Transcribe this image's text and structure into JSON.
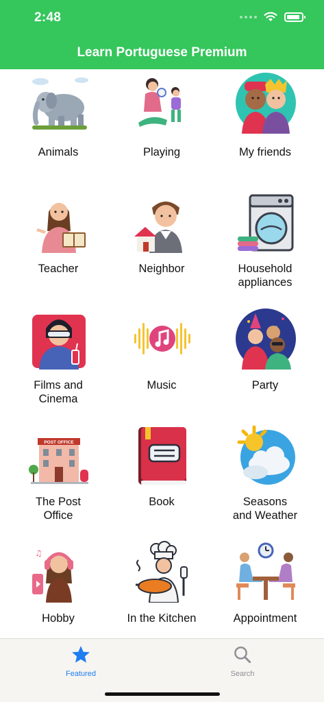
{
  "status_bar": {
    "time": "2:48",
    "icons": [
      "signal-dots-icon",
      "wifi-icon",
      "battery-icon"
    ]
  },
  "nav": {
    "title": "Learn Portuguese Premium"
  },
  "colors": {
    "header": "#35c65c",
    "tab_active": "#1f7ef0",
    "tab_inactive": "#8e8e93"
  },
  "categories": [
    {
      "label": "Animals",
      "icon": "elephant-icon"
    },
    {
      "label": "Playing",
      "icon": "mother-child-playing-icon"
    },
    {
      "label": "My friends",
      "icon": "friends-icon"
    },
    {
      "label": "Teacher",
      "icon": "teacher-icon"
    },
    {
      "label": "Neighbor",
      "icon": "neighbor-icon"
    },
    {
      "label": "Household\nappliances",
      "icon": "washing-machine-icon"
    },
    {
      "label": "Films and\nCinema",
      "icon": "cinema-viewer-icon"
    },
    {
      "label": "Music",
      "icon": "music-note-icon"
    },
    {
      "label": "Party",
      "icon": "party-icon"
    },
    {
      "label": "The Post\nOffice",
      "icon": "post-office-building-icon"
    },
    {
      "label": "Book",
      "icon": "book-icon"
    },
    {
      "label": "Seasons\nand Weather",
      "icon": "sun-cloud-icon"
    },
    {
      "label": "Hobby",
      "icon": "hobby-headphones-icon"
    },
    {
      "label": "In the Kitchen",
      "icon": "chef-cooking-icon"
    },
    {
      "label": "Appointment",
      "icon": "meeting-table-icon"
    }
  ],
  "post_office_sign": "POST OFFICE",
  "tabs": [
    {
      "label": "Featured",
      "icon": "star-icon",
      "active": true
    },
    {
      "label": "Search",
      "icon": "magnifier-icon",
      "active": false
    }
  ]
}
